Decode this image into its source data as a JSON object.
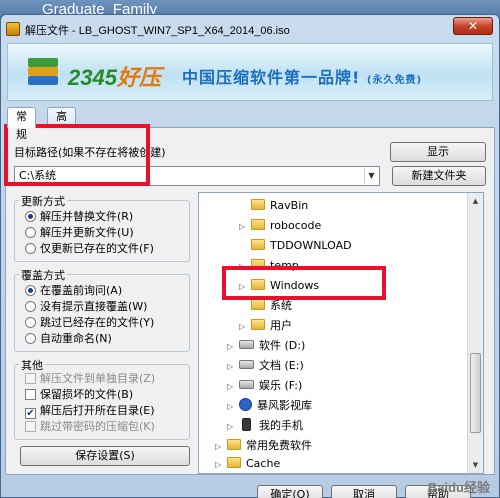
{
  "background_window_title": "Graduate_Family",
  "window": {
    "title": "解压文件 - LB_GHOST_WIN7_SP1_X64_2014_06.iso",
    "close_label": "✕"
  },
  "banner": {
    "logo_number": "2345",
    "logo_text": "好压",
    "slogan": "中国压缩软件第一品牌!",
    "slogan_note": "(永久免费)"
  },
  "tabs": [
    {
      "label": "常规",
      "active": true
    },
    {
      "label": "高级",
      "active": false
    }
  ],
  "destination": {
    "label": "目标路径(如果不存在将被创建)",
    "value": "C:\\系统",
    "show_button": "显示",
    "new_folder_button": "新建文件夹"
  },
  "update_mode": {
    "title": "更新方式",
    "options": [
      {
        "label": "解压并替换文件(R)",
        "selected": true
      },
      {
        "label": "解压并更新文件(U)",
        "selected": false
      },
      {
        "label": "仅更新已存在的文件(F)",
        "selected": false
      }
    ]
  },
  "overwrite_mode": {
    "title": "覆盖方式",
    "options": [
      {
        "label": "在覆盖前询问(A)",
        "selected": true
      },
      {
        "label": "没有提示直接覆盖(W)",
        "selected": false
      },
      {
        "label": "跳过已经存在的文件(Y)",
        "selected": false
      },
      {
        "label": "自动重命名(N)",
        "selected": false
      }
    ]
  },
  "other": {
    "title": "其他",
    "options": [
      {
        "label": "解压文件到单独目录(Z)",
        "checked": false,
        "disabled": true
      },
      {
        "label": "保留损坏的文件(B)",
        "checked": false,
        "disabled": false
      },
      {
        "label": "解压后打开所在目录(E)",
        "checked": true,
        "disabled": false
      },
      {
        "label": "跳过带密码的压缩包(K)",
        "checked": false,
        "disabled": true
      }
    ]
  },
  "save_settings_button": "保存设置(S)",
  "tree": [
    {
      "label": "RavBin",
      "icon": "folder-icon",
      "level": 2
    },
    {
      "label": "robocode",
      "icon": "folder-icon",
      "level": 2
    },
    {
      "label": "TDDOWNLOAD",
      "icon": "folder-icon",
      "level": 2
    },
    {
      "label": "temp",
      "icon": "folder-icon",
      "level": 2
    },
    {
      "label": "Windows",
      "icon": "folder-icon",
      "level": 2
    },
    {
      "label": "系统",
      "icon": "folder-icon",
      "level": 2,
      "selected": true
    },
    {
      "label": "用户",
      "icon": "folder-icon",
      "level": 2
    },
    {
      "label": "软件 (D:)",
      "icon": "drive-icon",
      "level": 1
    },
    {
      "label": "文档 (E:)",
      "icon": "drive-icon",
      "level": 1
    },
    {
      "label": "娱乐 (F:)",
      "icon": "drive-icon",
      "level": 1
    },
    {
      "label": "暴风影视库",
      "icon": "media-library-icon",
      "level": 1
    },
    {
      "label": "我的手机",
      "icon": "phone-icon",
      "level": 1
    },
    {
      "label": "常用免费软件",
      "icon": "folder-icon",
      "level": 0
    },
    {
      "label": "Cache",
      "icon": "folder-icon",
      "level": 0
    }
  ],
  "buttons": {
    "ok": "确定(O)",
    "cancel": "取消",
    "help": "帮助"
  },
  "watermark": "Baidu经验",
  "colors": {
    "highlight_red": "#e8102a",
    "logo_green": "#2a8a2a",
    "slogan_blue": "#1e6fbf"
  }
}
